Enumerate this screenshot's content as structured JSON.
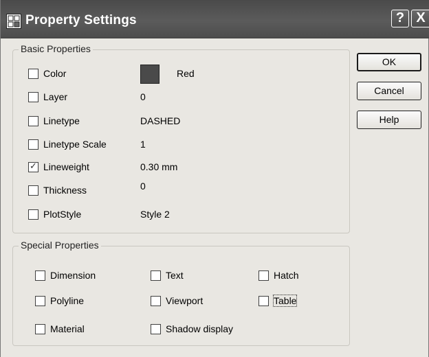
{
  "window": {
    "title": "Property Settings",
    "title_bar_buttons": [
      "?",
      "X"
    ]
  },
  "basic_properties": {
    "legend": "Basic Properties",
    "items": [
      {
        "label": "Color",
        "checked": false,
        "value": "Red"
      },
      {
        "label": "Layer",
        "checked": false,
        "value": "0"
      },
      {
        "label": "Linetype",
        "checked": false,
        "value": "DASHED"
      },
      {
        "label": "Linetype Scale",
        "checked": false,
        "value": "1"
      },
      {
        "label": "Lineweight",
        "checked": true,
        "value": "0.30 mm"
      },
      {
        "label": "Thickness",
        "checked": false,
        "value": "0"
      },
      {
        "label": "PlotStyle",
        "checked": false,
        "value": "Style 2"
      }
    ],
    "color_swatch": "#4a4a4a"
  },
  "special_properties": {
    "legend": "Special Properties",
    "items": [
      {
        "label": "Dimension",
        "checked": false
      },
      {
        "label": "Text",
        "checked": false
      },
      {
        "label": "Hatch",
        "checked": false
      },
      {
        "label": "Polyline",
        "checked": false
      },
      {
        "label": "Viewport",
        "checked": false
      },
      {
        "label": "Table",
        "checked": false
      },
      {
        "label": "Material",
        "checked": false
      },
      {
        "label": "Shadow display",
        "checked": false
      }
    ]
  },
  "buttons": {
    "ok": "OK",
    "cancel": "Cancel",
    "help": "Help"
  },
  "check_mark": "✓"
}
